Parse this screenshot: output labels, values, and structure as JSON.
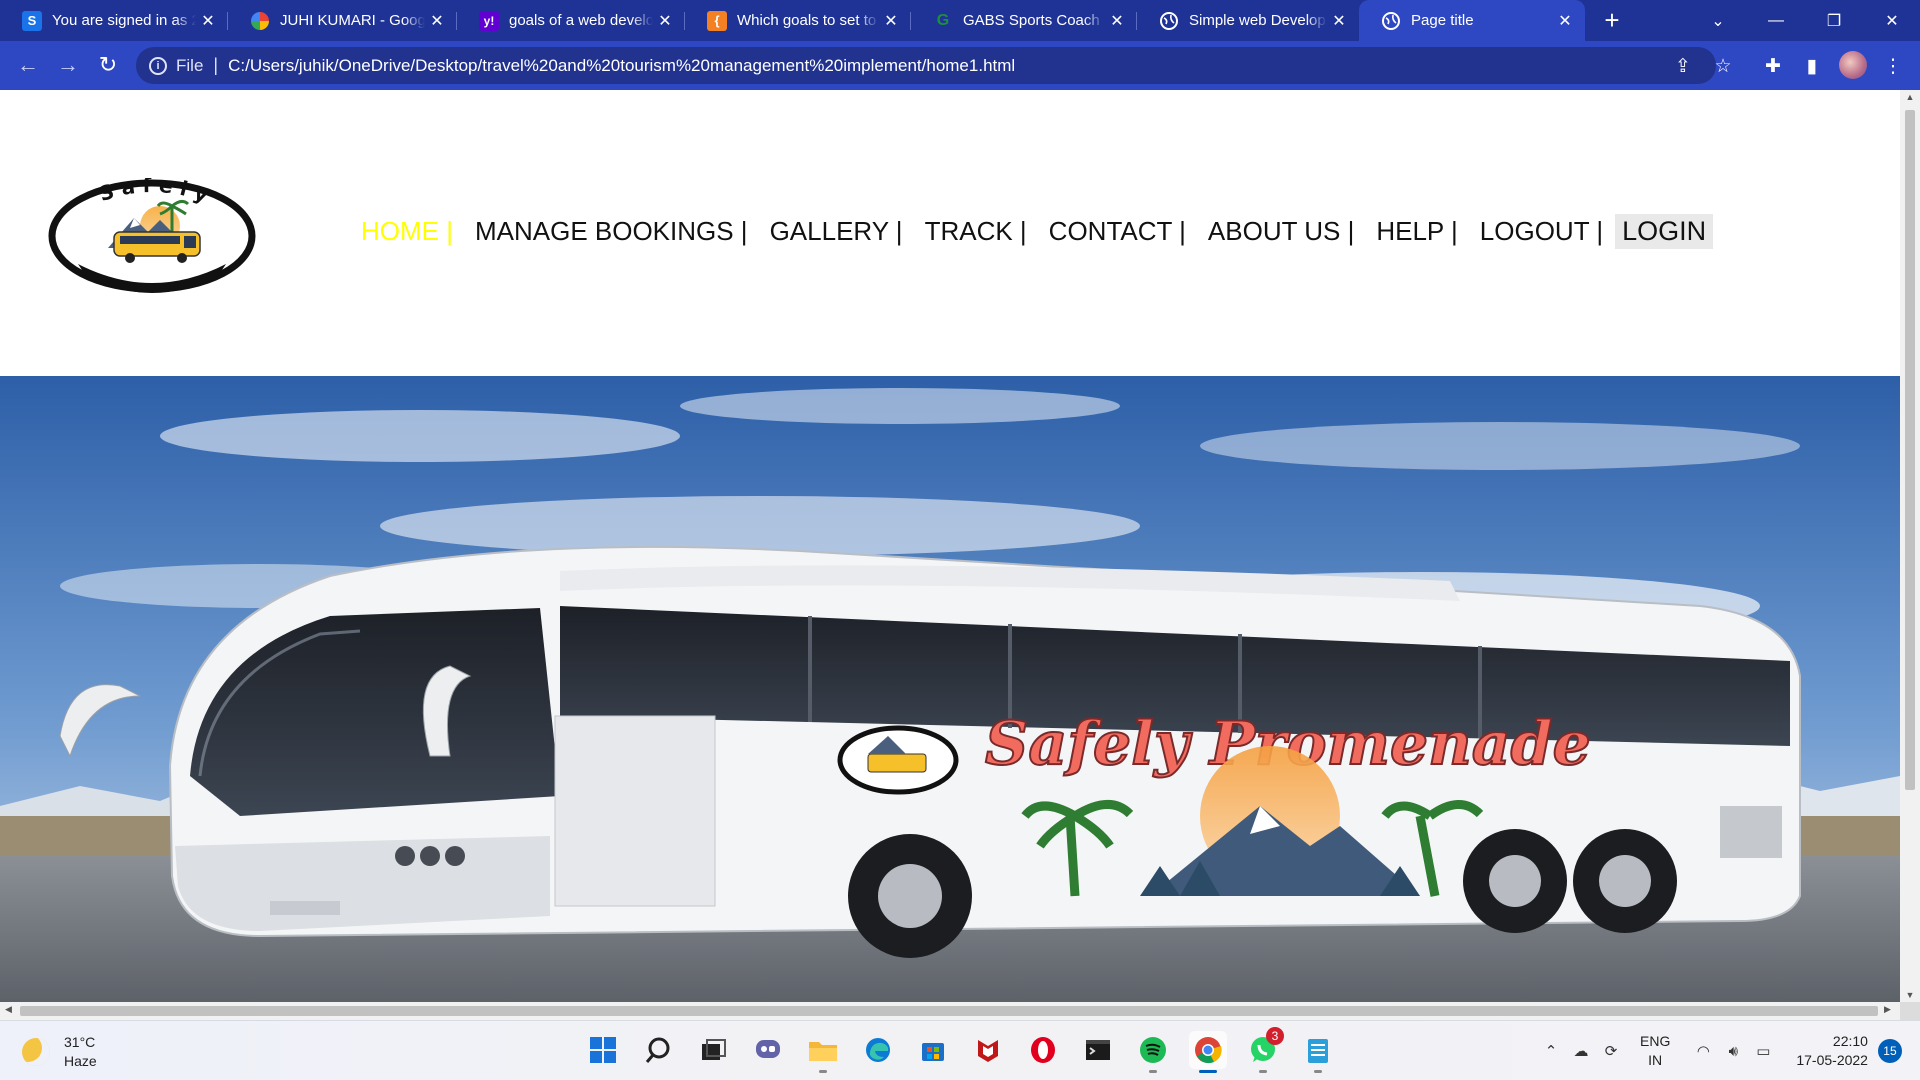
{
  "browser": {
    "tabs": [
      {
        "title": "You are signed in as 2",
        "favicon": "s-letter-icon",
        "favicon_text": "S",
        "favicon_color": "#1a73e8"
      },
      {
        "title": "JUHI KUMARI - Googl",
        "favicon": "pinwheel-icon",
        "favicon_text": "",
        "favicon_color": "#f4b400"
      },
      {
        "title": "goals of a web develo",
        "favicon": "yahoo-icon",
        "favicon_text": "y!",
        "favicon_color": "#6001d2"
      },
      {
        "title": "Which goals to set to",
        "favicon": "bracket-icon",
        "favicon_text": "{",
        "favicon_color": "#f48024"
      },
      {
        "title": "GABS Sports Coach | C",
        "favicon": "gabs-icon",
        "favicon_text": "G",
        "favicon_color": "#1e8e3e"
      },
      {
        "title": "Simple web Developm",
        "favicon": "globe-icon",
        "favicon_text": "",
        "favicon_color": "#ffffff"
      },
      {
        "title": "Page title",
        "favicon": "globe-icon",
        "favicon_text": "",
        "favicon_color": "#ffffff"
      }
    ],
    "active_tab": 6,
    "new_tab_label": "+",
    "address": {
      "scheme_label": "File",
      "url": "C:/Users/juhik/OneDrive/Desktop/travel%20and%20tourism%20management%20implement/home1.html"
    }
  },
  "site": {
    "logo": {
      "top_text": "Safely",
      "bottom_text": "promenade"
    },
    "nav": [
      {
        "label": "HOME |",
        "current": true
      },
      {
        "label": "MANAGE BOOKINGS |",
        "current": false
      },
      {
        "label": "GALLERY |",
        "current": false
      },
      {
        "label": "TRACK |",
        "current": false
      },
      {
        "label": "CONTACT |",
        "current": false
      },
      {
        "label": "ABOUT US |",
        "current": false
      },
      {
        "label": "HELP |",
        "current": false
      },
      {
        "label": "LOGOUT |",
        "current": false
      }
    ],
    "login_label": "LOGIN",
    "hero": {
      "bus_brand": "Safely Promenade"
    },
    "colors": {
      "nav_current": "#ffff00",
      "sky_top": "#2d5fa8",
      "brand_red": "#f26b5f",
      "brand_yellow": "#f7e27a"
    }
  },
  "taskbar": {
    "weather": {
      "temp": "31°C",
      "condition": "Haze"
    },
    "apps": [
      {
        "name": "start-icon"
      },
      {
        "name": "search-icon"
      },
      {
        "name": "task-view-icon"
      },
      {
        "name": "chat-icon"
      },
      {
        "name": "file-explorer-icon"
      },
      {
        "name": "edge-icon"
      },
      {
        "name": "store-icon"
      },
      {
        "name": "mcafee-icon"
      },
      {
        "name": "opera-icon"
      },
      {
        "name": "terminal-icon"
      },
      {
        "name": "spotify-icon"
      },
      {
        "name": "chrome-icon"
      },
      {
        "name": "whatsapp-icon",
        "badge": "3"
      },
      {
        "name": "notepad-icon"
      }
    ],
    "language": {
      "line1": "ENG",
      "line2": "IN"
    },
    "clock": {
      "time": "22:10",
      "date": "17-05-2022"
    },
    "notifications": "15"
  }
}
